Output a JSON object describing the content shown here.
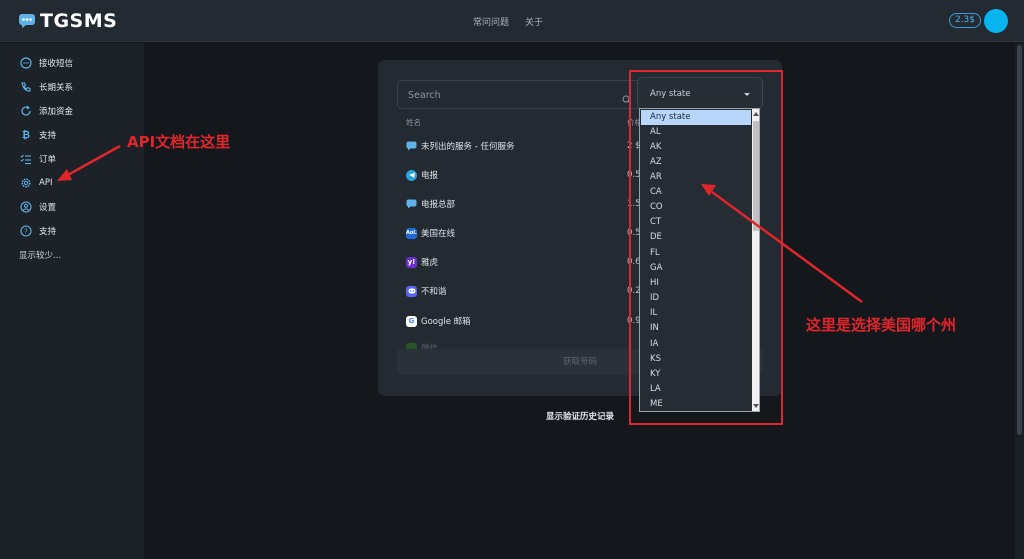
{
  "app": {
    "logo_text": "TGSMS"
  },
  "header": {
    "nav": [
      "常问问题",
      "关于"
    ],
    "balance": "2.3$"
  },
  "sidebar": {
    "items": [
      {
        "label": "接收短信",
        "icon": "chat-icon"
      },
      {
        "label": "长期关系",
        "icon": "phone-icon"
      },
      {
        "label": "添加资金",
        "icon": "refresh-icon"
      },
      {
        "label": "支持",
        "icon": "bitcoin-icon"
      },
      {
        "label": "订单",
        "icon": "list-icon"
      },
      {
        "label": "API",
        "icon": "gear-icon"
      },
      {
        "label": "设置",
        "icon": "user-icon"
      },
      {
        "label": "支持",
        "icon": "help-icon"
      }
    ],
    "more": "显示较少..."
  },
  "main": {
    "search_placeholder": "Search",
    "state_select": "Any state",
    "columns": {
      "name": "姓名",
      "price": "价格"
    },
    "services": [
      {
        "name": "未列出的服务 - 任何服务",
        "price": "2 $",
        "icon": "chat-bubble-icon",
        "color": "#3a8fd9"
      },
      {
        "name": "电报",
        "price": "0.5",
        "icon": "telegram-icon",
        "color": "#2aa3d9"
      },
      {
        "name": "电报总部",
        "price": "1.5",
        "icon": "chat-bubble-icon",
        "color": "#3a8fd9"
      },
      {
        "name": "美国在线",
        "price": "0.5",
        "icon": "aol-icon",
        "color": "#1f6ad6"
      },
      {
        "name": "雅虎",
        "price": "0.6",
        "icon": "yahoo-icon",
        "color": "#6b2fd1"
      },
      {
        "name": "不和谐",
        "price": "0.2",
        "icon": "discord-icon",
        "color": "#5865f2"
      },
      {
        "name": "Google 邮箱",
        "price": "0.9",
        "icon": "google-icon",
        "color": "#ffffff"
      },
      {
        "name": "微信",
        "price": "",
        "icon": "wechat-icon",
        "color": "#2dc100"
      }
    ],
    "get_number": "获取号码",
    "history": "显示验证历史记录"
  },
  "dropdown": {
    "options": [
      "Any state",
      "AL",
      "AK",
      "AZ",
      "AR",
      "CA",
      "CO",
      "CT",
      "DE",
      "FL",
      "GA",
      "HI",
      "ID",
      "IL",
      "IN",
      "IA",
      "KS",
      "KY",
      "LA",
      "ME"
    ],
    "selected": "Any state"
  },
  "annotations": {
    "api_note": "API文档在这里",
    "state_note": "这里是选择美国哪个州"
  }
}
